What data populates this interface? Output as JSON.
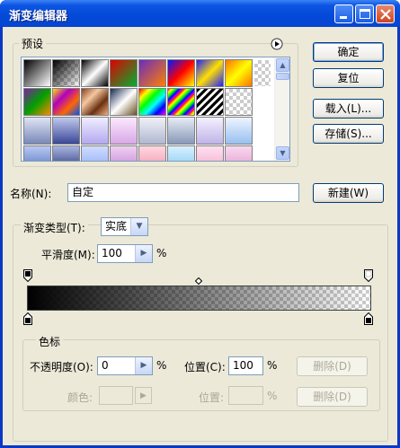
{
  "window": {
    "title": "渐变编辑器"
  },
  "presets": {
    "label": "预设",
    "swatches": [
      [
        "#000-#fff",
        "checker-dark",
        "#000-#fff-#000",
        "red-green",
        "violet-orange",
        "blue-red-yellow",
        "blue-yellow-blue",
        "orange-yellow-orange",
        "checker"
      ],
      [
        "violet-green-orange",
        "yellow-violet-orange-blue",
        "copper",
        "chrome",
        "spectrum",
        "stripes-rainbow",
        "stripes-bw",
        "checker",
        "blank"
      ],
      [
        "blue-gray",
        "blue-dark",
        "lavender",
        "pink",
        "violet",
        "steel",
        "silver",
        "pinkblue",
        "lightblue"
      ],
      [
        "blue-bot",
        "navy-bot",
        "periwinkle",
        "lilac",
        "pink-bot",
        "sky",
        "rose",
        "pink2",
        "blank"
      ]
    ]
  },
  "buttons": {
    "ok": "确定",
    "reset": "复位",
    "load": "载入(L)...",
    "save": "存储(S)...",
    "new": "新建(W)",
    "delete_opacity": "删除(D)",
    "delete_color": "删除(D)"
  },
  "name": {
    "label": "名称(N):",
    "value": "自定"
  },
  "gradient_type": {
    "label": "渐变类型(T):",
    "value": "实底"
  },
  "smoothness": {
    "label": "平滑度(M):",
    "value": "100",
    "unit": "%"
  },
  "stops": {
    "label": "色标",
    "opacity_label": "不透明度(O):",
    "opacity_value": "0",
    "opacity_unit": "%",
    "position_label": "位置(C):",
    "position_value": "100",
    "position_unit": "%",
    "color_label": "颜色:",
    "color_position_label": "位置:",
    "color_position_unit": "%"
  },
  "colors": {
    "accent": "#0449d8",
    "gradient_start": "#000000"
  }
}
